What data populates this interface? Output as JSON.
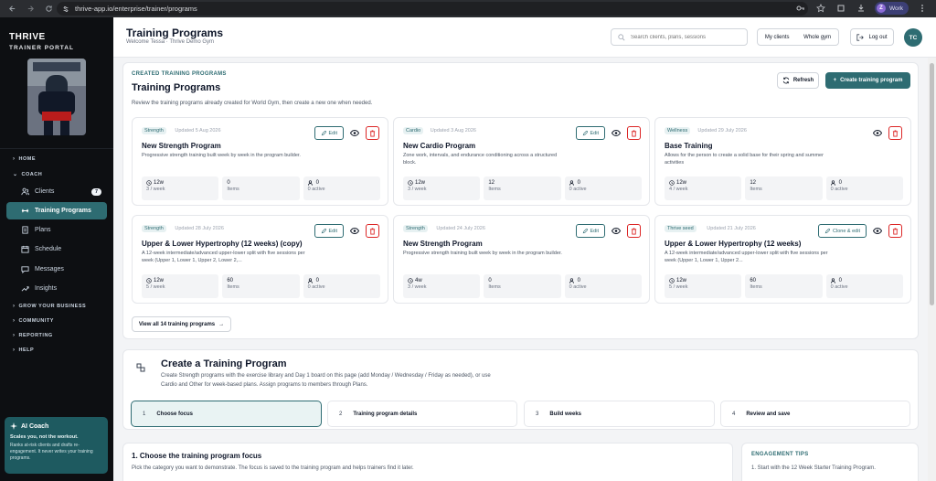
{
  "browser": {
    "url": "thrive-app.io/enterprise/trainer/programs",
    "profile_initial": "Z",
    "profile_label": "Work"
  },
  "sidebar": {
    "brand": "THRIVE",
    "subtitle": "TRAINER PORTAL",
    "sections": {
      "home": "HOME",
      "coach": "COACH",
      "grow": "GROW YOUR BUSINESS",
      "community": "COMMUNITY",
      "reporting": "REPORTING",
      "help": "HELP"
    },
    "items": [
      {
        "label": "Clients",
        "badge": "7",
        "icon": "users-icon"
      },
      {
        "label": "Training Programs",
        "icon": "dumbbell-icon"
      },
      {
        "label": "Plans",
        "icon": "document-icon"
      },
      {
        "label": "Schedule",
        "icon": "calendar-icon"
      },
      {
        "label": "Messages",
        "icon": "chat-icon"
      },
      {
        "label": "Insights",
        "icon": "trend-icon"
      }
    ],
    "ai_coach": {
      "title": "AI Coach",
      "tagline": "Scales you, not the workout.",
      "description": "Ranks at-risk clients and drafts re-engagement. It never writes your training programs."
    }
  },
  "header": {
    "title": "Training Programs",
    "subtitle": "Welcome Tessa · Thrive Demo Gym",
    "search_placeholder": "Search clients, plans, sessions",
    "toggle": [
      "My clients",
      "Whole gym"
    ],
    "logout": "Log out",
    "avatar_initials": "TC"
  },
  "created": {
    "eyebrow": "CREATED TRAINING PROGRAMS",
    "title": "Training Programs",
    "description": "Review the training programs already created for World Gym, then create a new one when needed.",
    "refresh": "Refresh",
    "create": "Create training program",
    "view_all": "View all 14 training programs",
    "programs": [
      {
        "tag": "Strength",
        "updated": "Updated 5 Aug 2026",
        "name": "New Strength Program",
        "desc": "Progressive strength training built week by week in the program builder.",
        "action": "Edit",
        "weeks": "12w",
        "freq": "3 / week",
        "items": "0",
        "active": "0",
        "items_label": "Items",
        "active_label": "0 active"
      },
      {
        "tag": "Cardio",
        "updated": "Updated 3 Aug 2026",
        "name": "New Cardio Program",
        "desc": "Zone work, intervals, and endurance conditioning across a structured block.",
        "action": "Edit",
        "weeks": "12w",
        "freq": "3 / week",
        "items": "12",
        "active": "0",
        "items_label": "Items",
        "active_label": "0 active"
      },
      {
        "tag": "Wellness",
        "updated": "Updated 29 July 2026",
        "name": "Base Training",
        "desc": "Allows for the person to create a solid base for their spring and summer activities",
        "action": "",
        "weeks": "12w",
        "freq": "4 / week",
        "items": "12",
        "active": "0",
        "items_label": "Items",
        "active_label": "0 active"
      },
      {
        "tag": "Strength",
        "updated": "Updated 28 July 2026",
        "name": "Upper & Lower Hypertrophy (12 weeks) (copy)",
        "desc": "A 12-week intermediate/advanced upper-lower split with five sessions per week (Upper 1, Lower 1, Upper 2, Lower 2,...",
        "action": "Edit",
        "weeks": "12w",
        "freq": "5 / week",
        "items": "60",
        "active": "0",
        "items_label": "Items",
        "active_label": "0 active"
      },
      {
        "tag": "Strength",
        "updated": "Updated 24 July 2026",
        "name": "New Strength Program",
        "desc": "Progressive strength training built week by week in the program builder.",
        "action": "Edit",
        "weeks": "4w",
        "freq": "3 / week",
        "items": "0",
        "active": "0",
        "items_label": "Items",
        "active_label": "0 active"
      },
      {
        "tag": "Thrive seed",
        "updated": "Updated 21 July 2026",
        "name": "Upper & Lower Hypertrophy (12 weeks)",
        "desc": "A 12-week intermediate/advanced upper-lower split with five sessions per week (Upper 1, Lower 1, Upper 2...",
        "action": "Clone & edit",
        "weeks": "12w",
        "freq": "5 / week",
        "items": "60",
        "active": "0",
        "items_label": "Items",
        "active_label": "0 active"
      }
    ]
  },
  "create_section": {
    "title": "Create a Training Program",
    "description_1": "Create Strength programs with the exercise library and Day 1 board on this page (add Monday / Wednesday / Friday as needed), or use",
    "description_2": "Cardio and Other for week-based plans. Assign programs to members through Plans.",
    "steps": [
      {
        "n": "1",
        "label": "Choose focus"
      },
      {
        "n": "2",
        "label": "Training program details"
      },
      {
        "n": "3",
        "label": "Build weeks"
      },
      {
        "n": "4",
        "label": "Review and save"
      }
    ]
  },
  "focus_section": {
    "title": "1. Choose the training program focus",
    "description": "Pick the category you want to demonstrate. The focus is saved to the training program and helps trainers find it later."
  },
  "tips": {
    "title": "ENGAGEMENT TIPS",
    "item_1": "1. Start with the 12 Week Starter Training Program."
  },
  "colors": {
    "accent": "#2e6c72",
    "sidebar_bg": "#0d0f12",
    "danger": "#dc2626"
  }
}
